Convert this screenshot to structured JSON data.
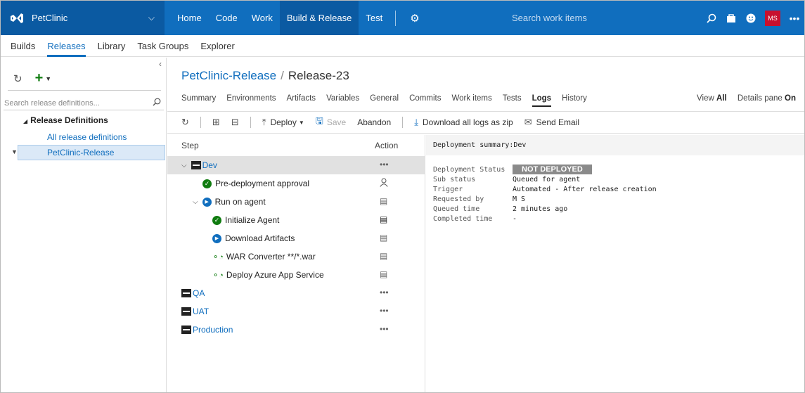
{
  "topbar": {
    "project": "PetClinic",
    "nav": [
      "Home",
      "Code",
      "Work",
      "Build & Release",
      "Test"
    ],
    "active_nav": "Build & Release",
    "search_placeholder": "Search work items",
    "avatar_initials": "MS"
  },
  "subnav": {
    "items": [
      "Builds",
      "Releases",
      "Library",
      "Task Groups",
      "Explorer"
    ],
    "active": "Releases"
  },
  "left": {
    "search_placeholder": "Search release definitions...",
    "section_title": "Release Definitions",
    "all_defs": "All release definitions",
    "selected_def": "PetClinic-Release"
  },
  "main": {
    "breadcrumb_link": "PetClinic-Release",
    "breadcrumb_sep": "/",
    "breadcrumb_current": "Release-23",
    "tabs": [
      "Summary",
      "Environments",
      "Artifacts",
      "Variables",
      "General",
      "Commits",
      "Work items",
      "Tests",
      "Logs",
      "History"
    ],
    "active_tab": "Logs",
    "view_label": "View",
    "view_value": "All",
    "details_label": "Details pane",
    "details_value": "On",
    "toolbar": {
      "deploy": "Deploy",
      "save": "Save",
      "abandon": "Abandon",
      "download": "Download all logs as zip",
      "email": "Send Email"
    },
    "steps_header": {
      "step": "Step",
      "action": "Action"
    },
    "steps": {
      "dev": "Dev",
      "pre_approval": "Pre-deployment approval",
      "run_on_agent": "Run on agent",
      "init_agent": "Initialize Agent",
      "download_artifacts": "Download Artifacts",
      "war_converter": "WAR Converter **/*.war",
      "deploy_azure": "Deploy Azure App Service",
      "qa": "QA",
      "uat": "UAT",
      "production": "Production",
      "more": "•••"
    },
    "summary": {
      "title": "Deployment summary:Dev",
      "status_label": "Deployment Status",
      "status_value": "NOT DEPLOYED",
      "sub_status_label": "Sub status",
      "sub_status_value": "Queued for agent",
      "trigger_label": "Trigger",
      "trigger_value": "Automated - After release creation",
      "requested_label": "Requested by",
      "requested_value": "M S",
      "queued_label": "Queued time",
      "queued_value": "2 minutes ago",
      "completed_label": "Completed time",
      "completed_value": "-"
    }
  },
  "colors": {
    "brand_blue": "#106ebe",
    "success_green": "#107c10",
    "status_gray": "#8a8a8a"
  }
}
